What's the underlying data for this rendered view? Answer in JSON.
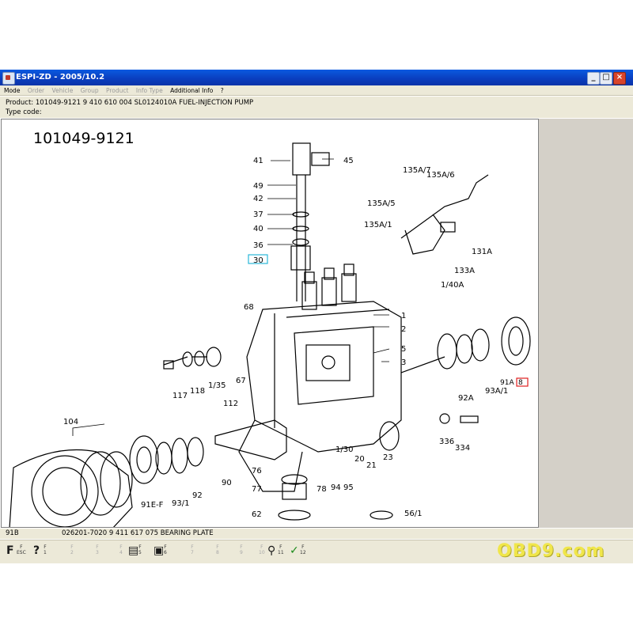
{
  "window": {
    "title": "ESPI-ZD - 2005/10.2",
    "controls": {
      "minimize": "_",
      "maximize": "□",
      "close": "×"
    }
  },
  "menu": {
    "items": [
      "Mode",
      "Order",
      "Vehicle",
      "Group",
      "Product",
      "Info Type",
      "Additional Info",
      "?"
    ],
    "enabled": [
      true,
      false,
      false,
      false,
      false,
      false,
      true,
      true
    ]
  },
  "product_info": {
    "product_line": "Product:  101049-9121   9 410 610 004   SL0124010A   FUEL-INJECTION PUMP",
    "type_code_label": "Type code:"
  },
  "drawing": {
    "title": "101049-9121",
    "part_labels": [
      "41",
      "45",
      "49",
      "42",
      "37",
      "40",
      "36",
      "30",
      "135A/7",
      "135A/6",
      "135A/5",
      "135A/1",
      "131A",
      "133A",
      "1/40A",
      "68",
      "1",
      "2",
      "5",
      "3",
      "91A",
      "8",
      "117",
      "118",
      "1/35",
      "67",
      "92A",
      "93A/1",
      "112",
      "104",
      "336",
      "334",
      "1/30",
      "20",
      "21",
      "23",
      "76",
      "77",
      "78",
      "94",
      "95",
      "62",
      "56/1",
      "91E-F",
      "93/1",
      "92",
      "90"
    ],
    "highlighted_labels": [
      "30",
      "8"
    ]
  },
  "status": {
    "code": "91B",
    "description": "026201-7020   9 411 617 075   BEARING PLATE"
  },
  "toolbar": {
    "keys": [
      {
        "glyph": "F",
        "label": "F\nESC",
        "enabled": true
      },
      {
        "glyph": "?",
        "label": "F\n1",
        "enabled": true
      },
      {
        "glyph": "",
        "label": "F\n2",
        "enabled": false
      },
      {
        "glyph": "",
        "label": "F\n3",
        "enabled": false
      },
      {
        "glyph": "",
        "label": "F\n4",
        "enabled": false
      },
      {
        "glyph": "▤",
        "label": "F\n5",
        "enabled": true
      },
      {
        "glyph": "▣",
        "label": "F\n6",
        "enabled": true
      },
      {
        "glyph": "",
        "label": "F\n7",
        "enabled": false
      },
      {
        "glyph": "",
        "label": "F\n8",
        "enabled": false
      },
      {
        "glyph": "",
        "label": "F\n9",
        "enabled": false
      },
      {
        "glyph": "",
        "label": "F\n10",
        "enabled": false
      },
      {
        "glyph": "⚲",
        "label": "F\n11",
        "enabled": true
      },
      {
        "glyph": "✓",
        "label": "F\n12",
        "enabled": true
      }
    ]
  },
  "watermark": "OBD9.com",
  "colors": {
    "titlebar": "#0a3fc0",
    "highlight_cyan": "#2ab8d8",
    "highlight_red": "#e02020",
    "logo": "#f0e64a"
  }
}
